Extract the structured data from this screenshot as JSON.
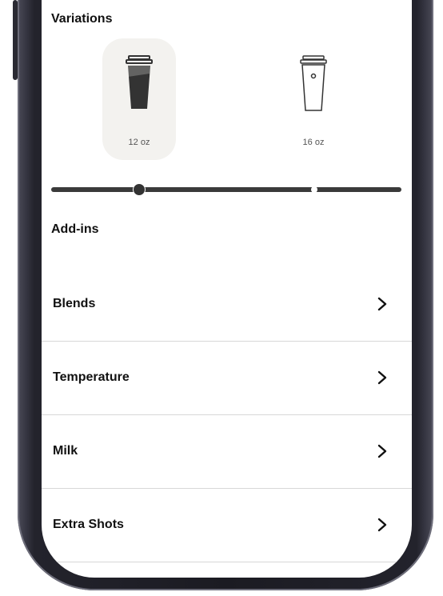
{
  "variations": {
    "title": "Variations",
    "options": [
      {
        "label": "12 oz",
        "selected": true
      },
      {
        "label": "16 oz",
        "selected": false
      }
    ],
    "slider_value": "12 oz"
  },
  "addins": {
    "title": "Add-ins",
    "rows": [
      {
        "label": "Blends"
      },
      {
        "label": "Temperature"
      },
      {
        "label": "Milk"
      },
      {
        "label": "Extra Shots"
      }
    ]
  },
  "icons": {
    "cup_small": "cup-icon",
    "cup_large": "cup-outline-icon",
    "row_arrow": "chevron-right-icon"
  },
  "colors": {
    "selected_bg": "#f3f2ef",
    "slider": "#3a3a3a",
    "text": "#111111"
  }
}
